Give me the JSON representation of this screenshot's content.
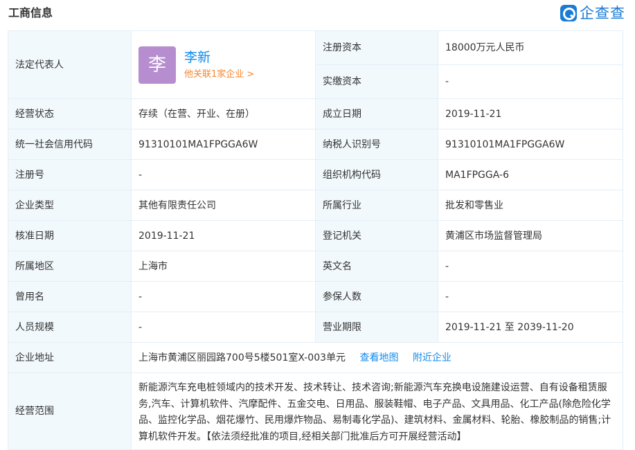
{
  "header": {
    "title": "工商信息",
    "brand_name": "企查查",
    "brand_icon": "qichacha-logo-icon"
  },
  "rep": {
    "label": "法定代表人",
    "avatar_char": "李",
    "name": "李新",
    "related": "他关联1家企业 >"
  },
  "fields": {
    "reg_capital_label": "注册资本",
    "reg_capital_value": "18000万元人民币",
    "paid_capital_label": "实缴资本",
    "paid_capital_value": "-",
    "status_label": "经营状态",
    "status_value": "存续（在营、开业、在册）",
    "founded_label": "成立日期",
    "founded_value": "2019-11-21",
    "credit_code_label": "统一社会信用代码",
    "credit_code_value": "91310101MA1FPGGA6W",
    "taxpayer_label": "纳税人识别号",
    "taxpayer_value": "91310101MA1FPGGA6W",
    "reg_no_label": "注册号",
    "reg_no_value": "-",
    "org_code_label": "组织机构代码",
    "org_code_value": "MA1FPGGA-6",
    "type_label": "企业类型",
    "type_value": "其他有限责任公司",
    "industry_label": "所属行业",
    "industry_value": "批发和零售业",
    "approve_label": "核准日期",
    "approve_value": "2019-11-21",
    "authority_label": "登记机关",
    "authority_value": "黄浦区市场监督管理局",
    "region_label": "所属地区",
    "region_value": "上海市",
    "english_label": "英文名",
    "english_value": "-",
    "former_label": "曾用名",
    "former_value": "-",
    "insured_label": "参保人数",
    "insured_value": "-",
    "size_label": "人员规模",
    "size_value": "-",
    "term_label": "营业期限",
    "term_value": "2019-11-21 至 2039-11-20",
    "address_label": "企业地址",
    "address_value": "上海市黄浦区丽园路700号5楼501室X-003单元",
    "view_map": "查看地图",
    "nearby": "附近企业",
    "scope_label": "经营范围",
    "scope_value": "新能源汽车充电桩领域内的技术开发、技术转让、技术咨询;新能源汽车充换电设施建设运营、自有设备租赁服务,汽车、计算机软件、汽摩配件、五金交电、日用品、服装鞋帽、电子产品、文具用品、化工产品(除危险化学品、监控化学品、烟花爆竹、民用爆炸物品、易制毒化学品)、建筑材料、金属材料、轮胎、橡胶制品的销售;计算机软件开发。【依法须经批准的项目,经相关部门批准后方可开展经营活动】"
  }
}
